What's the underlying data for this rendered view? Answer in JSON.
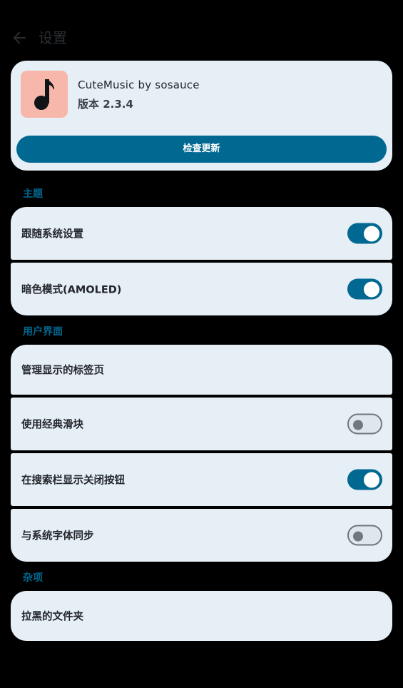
{
  "header": {
    "title": "设置",
    "back_icon": "arrow-left-icon"
  },
  "app_card": {
    "icon": "music-note-icon",
    "icon_bg": "#f7b7ab",
    "name": "CuteMusic by sosauce",
    "version": "版本 2.3.4",
    "update_button": "检查更新"
  },
  "sections": {
    "theme": {
      "title": "主题",
      "follow_system": {
        "label": "跟随系统设置",
        "enabled": true
      },
      "amoled": {
        "label": "暗色模式(AMOLED)",
        "enabled": true
      }
    },
    "ui": {
      "title": "用户界面",
      "manage_tabs": {
        "label": "管理显示的标签页"
      },
      "classic_slider": {
        "label": "使用经典滑块",
        "enabled": false
      },
      "close_button": {
        "label": "在搜索栏显示关闭按钮",
        "enabled": true
      },
      "system_font": {
        "label": "与系统字体同步",
        "enabled": false
      }
    },
    "misc": {
      "title": "杂项",
      "blacklisted_folders": {
        "label": "拉黑的文件夹"
      }
    }
  },
  "colors": {
    "accent": "#006891",
    "card_bg": "#e6eef6",
    "background": "#000000"
  }
}
